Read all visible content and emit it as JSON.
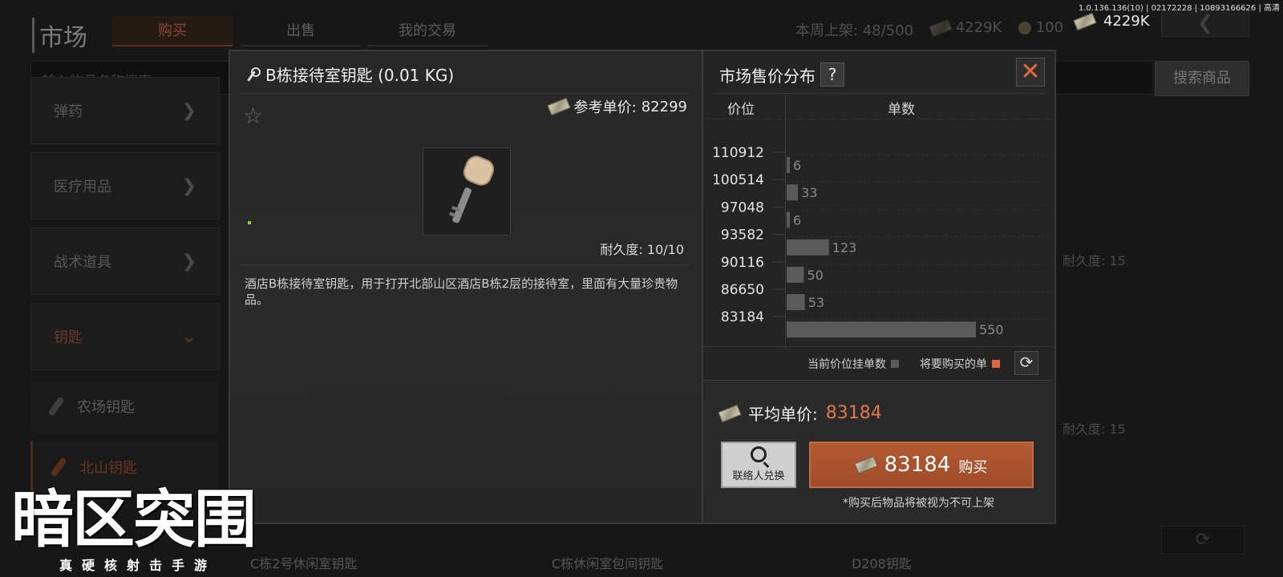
{
  "version": "1.0.136.136(10) | 02172228 | 10893166626 | 高清",
  "top_money": "4229K",
  "background": {
    "title": "市场",
    "tabs": [
      "购买",
      "出售",
      "我的交易"
    ],
    "weekly_listing_label": "本周上架:",
    "weekly_listing_value": "48/500",
    "money": "4229K",
    "coins": "100",
    "back_icon": "chevron-left-icon",
    "search_placeholder": "输入物品名称搜索",
    "search_button": "搜索商品",
    "categories": [
      "弹药",
      "医疗用品",
      "战术道具",
      "钥匙"
    ],
    "key_items": [
      "农场钥匙",
      "北山钥匙"
    ],
    "item_names": [
      "C栋2号休闲室钥匙",
      "C栋休闲室包间钥匙",
      "D208钥匙"
    ],
    "durability": [
      "耐久度: 15",
      "耐久度: 15"
    ]
  },
  "modal": {
    "item_title": "B栋接待室钥匙 (0.01 KG)",
    "ref_price_label": "参考单价:",
    "ref_price_value": "82299",
    "durability": "耐久度: 10/10",
    "description": "酒店B栋接待室钥匙，用于打开北部山区酒店B栋2层的接待室，里面有大量珍贵物品。",
    "distribution_title": "市场售价分布",
    "help_label": "?",
    "close_label": "✕",
    "col_price": "价位",
    "col_count": "单数",
    "legend_current": "当前价位挂单数",
    "legend_buy": "将要购买的单",
    "refresh_label": "⟳",
    "avg_price_label": "平均单价:",
    "avg_price_value": "83184",
    "contact_button": "联络人兑换",
    "buy_price": "83184",
    "buy_word": "购买",
    "buy_note": "*购买后物品将被视为不可上架"
  },
  "colors": {
    "accent": "#e07848",
    "buy_button": "#a84f2d",
    "bar": "#5a5a5a",
    "legend_buy": "#e0653a"
  },
  "chart_data": {
    "type": "bar",
    "orientation": "horizontal",
    "price_labels": [
      "110912",
      "100514",
      "97048",
      "93582",
      "90116",
      "86650",
      "83184"
    ],
    "bars": [
      {
        "value": 6,
        "label": "6"
      },
      {
        "value": 33,
        "label": "33"
      },
      {
        "value": 6,
        "label": "6"
      },
      {
        "value": 123,
        "label": "123"
      },
      {
        "value": 50,
        "label": "50"
      },
      {
        "value": 53,
        "label": "53"
      },
      {
        "value": 550,
        "label": "550"
      }
    ]
  },
  "logo": {
    "title": "暗区突围",
    "subtitle": "真硬核射击手游"
  }
}
